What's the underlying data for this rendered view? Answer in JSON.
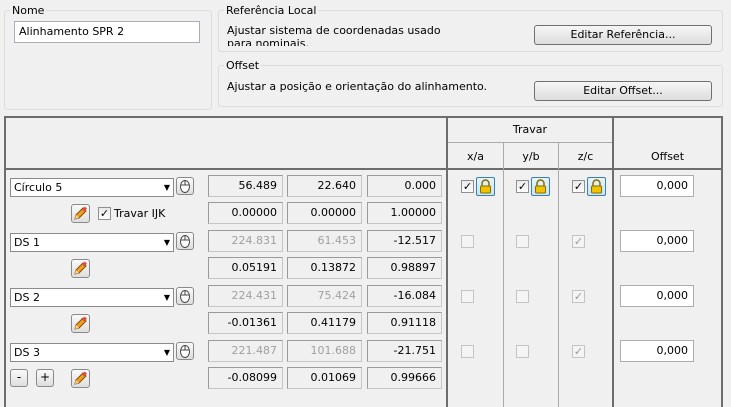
{
  "nome": {
    "title": "Nome",
    "value": "Alinhamento SPR 2"
  },
  "referencia": {
    "title": "Referência Local",
    "description": "Ajustar sistema de coordenadas  usado para nominais.",
    "button": "Editar Referência..."
  },
  "offset_group": {
    "title": "Offset",
    "description": "Ajustar a posição e orientação do alinhamento.",
    "button": "Editar Offset..."
  },
  "grid": {
    "header_travar": "Travar",
    "header_xa": "x/a",
    "header_yb": "y/b",
    "header_zc": "z/c",
    "header_offset": "Offset",
    "travar_ijk_label": "Travar IJK",
    "minus": "-",
    "plus": "+",
    "rows": [
      {
        "feature": "Círculo 5",
        "xyz": [
          "56.489",
          "22.640",
          "0.000"
        ],
        "ijk": [
          "0.00000",
          "0.00000",
          "1.00000"
        ],
        "offset": "0,000"
      },
      {
        "feature": "DS 1",
        "xyz": [
          "224.831",
          "61.453",
          "-12.517"
        ],
        "ijk": [
          "0.05191",
          "0.13872",
          "0.98897"
        ],
        "offset": "0,000"
      },
      {
        "feature": "DS 2",
        "xyz": [
          "224.431",
          "75.424",
          "-16.084"
        ],
        "ijk": [
          "-0.01361",
          "0.41179",
          "0.91118"
        ],
        "offset": "0,000"
      },
      {
        "feature": "DS 3",
        "xyz": [
          "221.487",
          "101.688",
          "-21.751"
        ],
        "ijk": [
          "-0.08099",
          "0.01069",
          "0.99666"
        ],
        "offset": "0,000"
      }
    ]
  },
  "colors": {
    "frame": "#6d6d6d",
    "lock_blue": "#3c7fb1",
    "lock_yellow": "#f2c200"
  }
}
